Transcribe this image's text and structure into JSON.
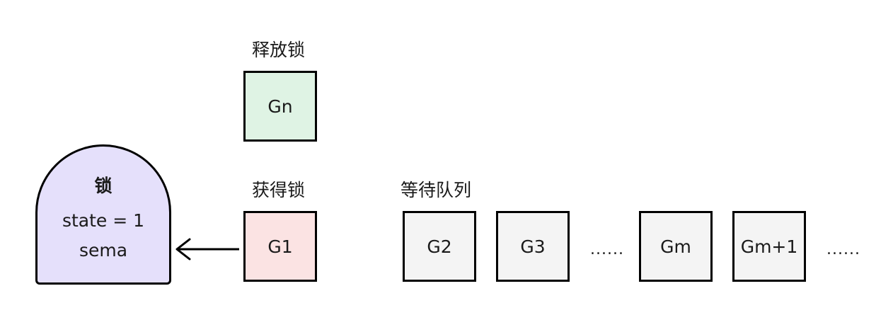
{
  "lock": {
    "title": "锁",
    "state_line": "state = 1",
    "sema_line": "sema"
  },
  "release": {
    "label": "释放锁",
    "goroutine": "Gn"
  },
  "acquire": {
    "label": "获得锁",
    "goroutine": "G1"
  },
  "queue": {
    "label": "等待队列",
    "items": [
      "G2",
      "G3",
      "Gm",
      "Gm+1"
    ],
    "ellipsis": "......"
  },
  "colors": {
    "released": "#dff3e4",
    "holder": "#fbe3e3",
    "waiting": "#f4f4f4",
    "lock": "#e5e0fb"
  }
}
